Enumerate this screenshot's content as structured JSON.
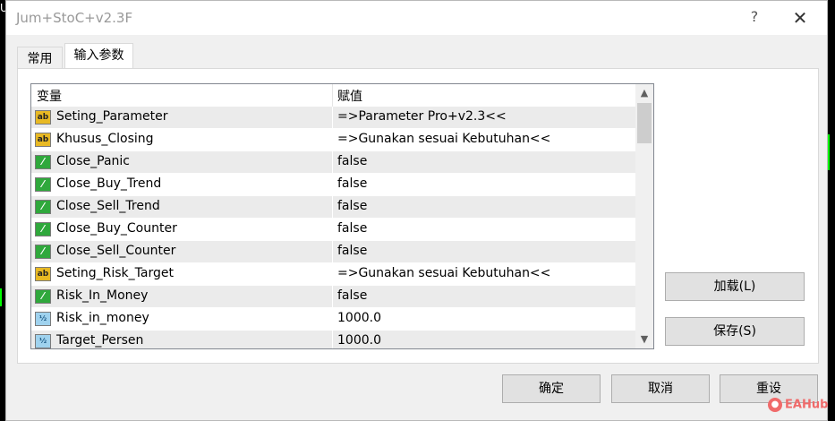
{
  "window": {
    "title": "Jum+StoC+v2.3F",
    "help": "?",
    "close": "✕"
  },
  "tabs": [
    {
      "label": "常用"
    },
    {
      "label": "输入参数"
    }
  ],
  "table": {
    "headers": {
      "variable": "变量",
      "value": "赋值"
    },
    "rows": [
      {
        "type": "string",
        "icon": "ab",
        "name": "Seting_Parameter",
        "value": "=>Parameter Pro+v2.3<<"
      },
      {
        "type": "string",
        "icon": "ab",
        "name": "Khusus_Closing",
        "value": "=>Gunakan sesuai Kebutuhan<<"
      },
      {
        "type": "bool",
        "icon": "⁄",
        "name": "Close_Panic",
        "value": "false"
      },
      {
        "type": "bool",
        "icon": "⁄",
        "name": "Close_Buy_Trend",
        "value": "false"
      },
      {
        "type": "bool",
        "icon": "⁄",
        "name": "Close_Sell_Trend",
        "value": "false"
      },
      {
        "type": "bool",
        "icon": "⁄",
        "name": "Close_Buy_Counter",
        "value": "false"
      },
      {
        "type": "bool",
        "icon": "⁄",
        "name": "Close_Sell_Counter",
        "value": "false"
      },
      {
        "type": "string",
        "icon": "ab",
        "name": "Seting_Risk_Target",
        "value": "=>Gunakan sesuai Kebutuhan<<"
      },
      {
        "type": "bool",
        "icon": "⁄",
        "name": "Risk_In_Money",
        "value": "false"
      },
      {
        "type": "number",
        "icon": "½",
        "name": "Risk_in_money",
        "value": "1000.0"
      },
      {
        "type": "number",
        "icon": "½",
        "name": "Target_Persen",
        "value": "1000.0"
      }
    ]
  },
  "buttons": {
    "load": "加载(L)",
    "save": "保存(S)",
    "ok": "确定",
    "cancel": "取消",
    "reset": "重设"
  },
  "scroll": {
    "up": "▲",
    "down": "▼"
  },
  "watermark": {
    "text": "EAHub"
  },
  "background": {
    "letter": "U"
  }
}
